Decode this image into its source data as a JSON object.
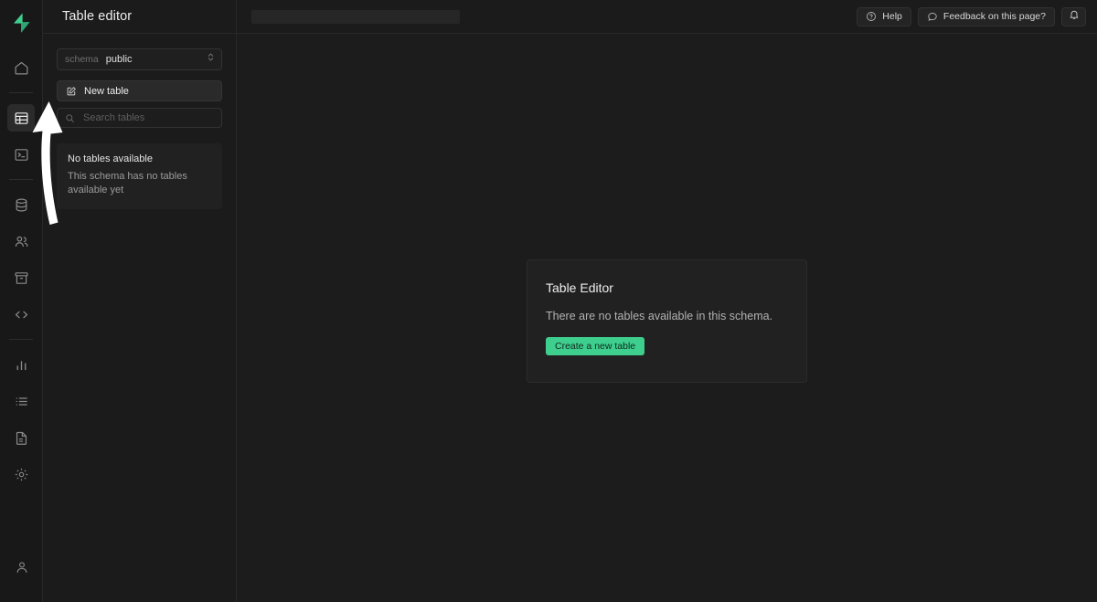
{
  "app": {
    "logo_icon": "supabase-lightning-logo",
    "brand_green": "#3ecf8e",
    "background": "#1c1c1c"
  },
  "rail": {
    "items": [
      {
        "name": "home",
        "icon": "home-icon",
        "active": false
      },
      {
        "name": "table-editor",
        "icon": "table-icon",
        "active": true
      },
      {
        "name": "sql-editor",
        "icon": "terminal-icon",
        "active": false
      },
      {
        "name": "database",
        "icon": "database-icon",
        "active": false
      },
      {
        "name": "authentication",
        "icon": "users-icon",
        "active": false
      },
      {
        "name": "storage",
        "icon": "archive-box-icon",
        "active": false
      },
      {
        "name": "api",
        "icon": "code-brackets-icon",
        "active": false
      },
      {
        "name": "reports",
        "icon": "bar-chart-icon",
        "active": false
      },
      {
        "name": "logs",
        "icon": "list-icon",
        "active": false
      },
      {
        "name": "docs",
        "icon": "document-icon",
        "active": false
      },
      {
        "name": "settings",
        "icon": "gear-icon",
        "active": false
      }
    ],
    "account": {
      "name": "account",
      "icon": "user-icon"
    }
  },
  "panel": {
    "title": "Table editor",
    "schema": {
      "label": "schema",
      "value": "public",
      "chevron_icon": "chevron-up-down-icon"
    },
    "new_table": {
      "label": "New table",
      "icon": "edit-square-icon"
    },
    "search": {
      "placeholder": "Search tables",
      "value": "",
      "icon": "search-icon"
    },
    "empty_state": {
      "title": "No tables available",
      "text": "This schema has no tables available yet"
    }
  },
  "topbar": {
    "breadcrumb_loading": true,
    "help": {
      "label": "Help",
      "icon": "question-circle-icon"
    },
    "feedback": {
      "label": "Feedback on this page?",
      "icon": "chat-bubble-icon"
    },
    "notifications": {
      "icon": "bell-icon"
    }
  },
  "main": {
    "card": {
      "title": "Table Editor",
      "description": "There are no tables available in this schema.",
      "button_label": "Create a new table"
    }
  },
  "annotation": {
    "arrow": "curved-up-arrow-pointing-to-table-editor-icon",
    "color": "#ffffff"
  }
}
